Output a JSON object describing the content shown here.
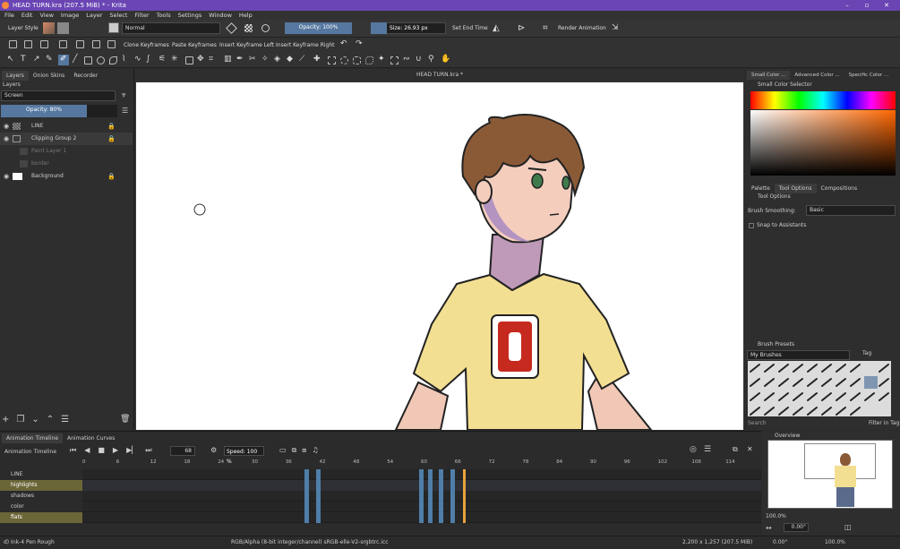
{
  "window": {
    "title": "HEAD TURN.kra (207.5 MiB)  * - Krita"
  },
  "menu": [
    "File",
    "Edit",
    "View",
    "Image",
    "Layer",
    "Select",
    "Filter",
    "Tools",
    "Settings",
    "Window",
    "Help"
  ],
  "toolbar": {
    "layer_style": "Layer Style",
    "blend_mode": "Normal",
    "opacity": "Opacity: 100%",
    "size": "Size: 26.93 px",
    "set_end_time": "Set End Time",
    "render_animation": "Render Animation",
    "clone_keyframes": "Clone Keyframes",
    "paste_keyframes": "Paste Keyframes",
    "insert_keyframe_left": "Insert Keyframe Left",
    "insert_keyframe_right": "Insert Keyframe Right"
  },
  "left_dock": {
    "tabs": [
      "Layers",
      "Onion Skins",
      "Recorder"
    ],
    "panel_title": "Layers",
    "blend_mode": "Screen",
    "opacity": "Opacity:  80%",
    "layers": [
      {
        "name": "LINE"
      },
      {
        "name": "Clipping Group 2"
      },
      {
        "name": "Paint Layer 1"
      },
      {
        "name": "border"
      },
      {
        "name": "Background"
      }
    ]
  },
  "canvas": {
    "title": "HEAD TURN.kra *"
  },
  "right_dock": {
    "top_tabs": [
      "Small Color ...",
      "Advanced Color ...",
      "Specific Color ..."
    ],
    "color_selector_title": "Small Color Selector",
    "mid_tabs": [
      "Palette",
      "Tool Options",
      "Compositions"
    ],
    "tool_options_title": "Tool Options",
    "brush_smoothing_label": "Brush Smoothing:",
    "brush_smoothing_value": "Basic",
    "snap_label": "Snap to Assistants",
    "presets_title": "Brush Presets",
    "presets_group": "My Brushes",
    "tag_label": "Tag",
    "search_placeholder": "Search",
    "filter_label": "Filter in Tag"
  },
  "timeline": {
    "tabs": [
      "Animation Timeline",
      "Animation Curves"
    ],
    "title": "Animation Timeline",
    "frame": "68",
    "speed": "Speed: 100 %",
    "ruler": [
      "0",
      "6",
      "12",
      "18",
      "24",
      "30",
      "36",
      "42",
      "48",
      "54",
      "60",
      "66",
      "72",
      "78",
      "84",
      "90",
      "96",
      "102",
      "108",
      "114"
    ],
    "layers": [
      {
        "name": "LINE",
        "highlight": false
      },
      {
        "name": "highlights",
        "highlight": true
      },
      {
        "name": "shadows",
        "highlight": false
      },
      {
        "name": "color",
        "highlight": false
      },
      {
        "name": "flats",
        "highlight": true
      }
    ]
  },
  "overview": {
    "title": "Overview",
    "zoom": "100.0%",
    "rotation": "0.00°"
  },
  "status": {
    "brush": "d) Ink-4 Pen Rough",
    "color_space": "RGB/Alpha (8-bit integer/channel)  sRGB-elle-V2-srgbtrc.icc",
    "dims": "2,200 x 1,257 (207.5 MiB)",
    "rotation": "0.00°",
    "zoom": "100.0%"
  },
  "colors": {
    "titlebar": "#6a45b3",
    "accent": "#5678a0",
    "highlight_row": "#6b6638",
    "playhead": "#e8a33a"
  }
}
